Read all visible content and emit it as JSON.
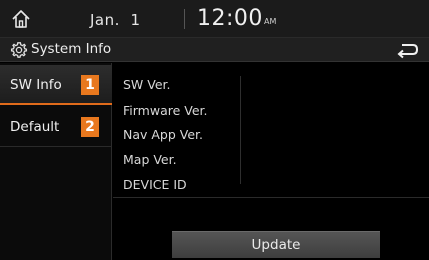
{
  "status_bar": {
    "date_month": "Jan.",
    "date_day": "1",
    "time": "12:00",
    "ampm": "AM"
  },
  "title_bar": {
    "title": "System Info"
  },
  "sidebar": {
    "items": [
      {
        "label": "SW Info",
        "badge": "1",
        "active": true
      },
      {
        "label": "Default",
        "badge": "2",
        "active": false
      }
    ]
  },
  "info": {
    "rows": [
      "SW Ver.",
      "Firmware Ver.",
      "Nav App Ver.",
      "Map Ver.",
      "DEVICE ID"
    ]
  },
  "actions": {
    "update_label": "Update"
  },
  "colors": {
    "accent": "#e8781e",
    "background": "#000000"
  }
}
